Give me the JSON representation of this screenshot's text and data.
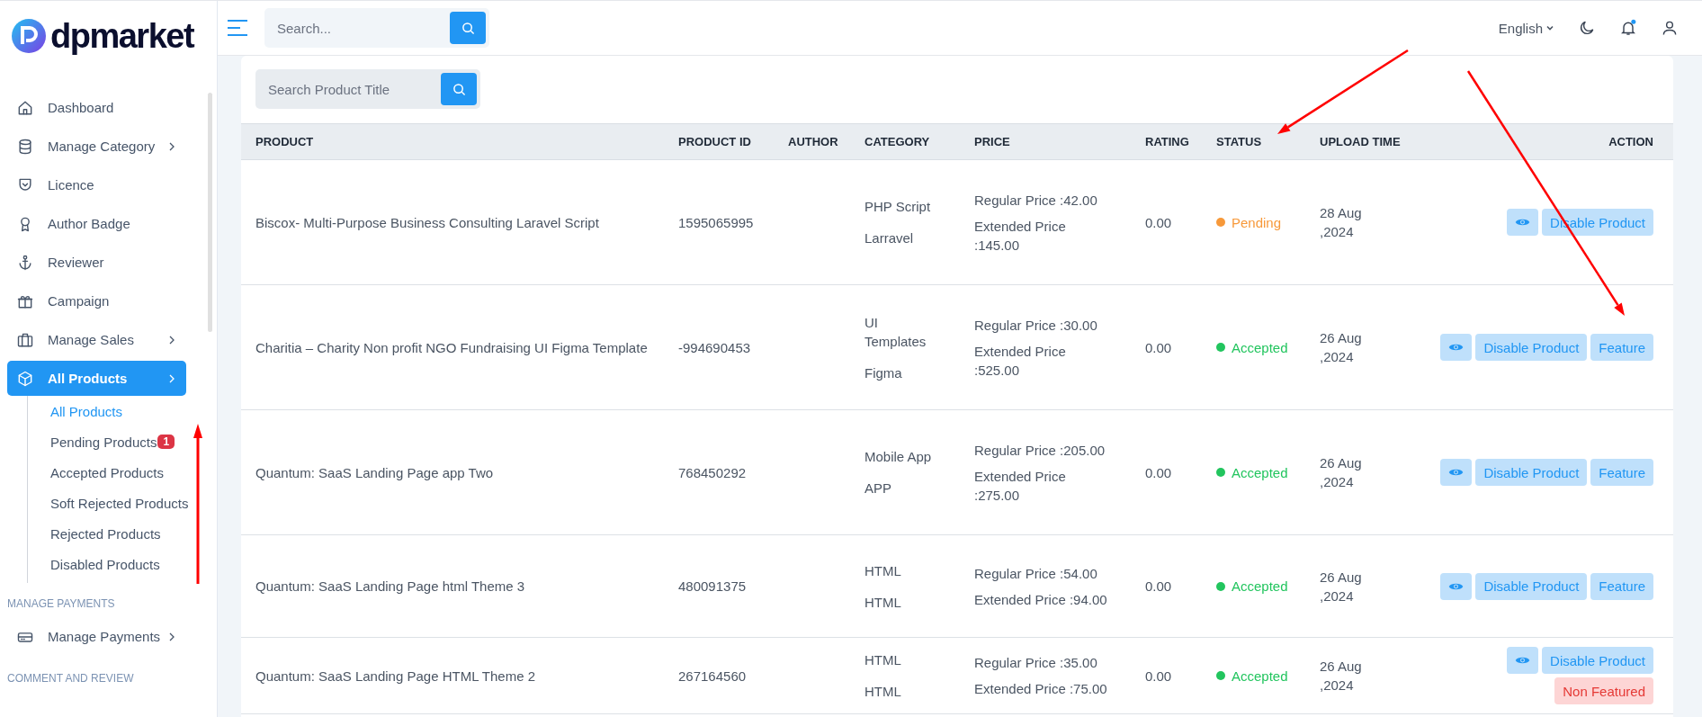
{
  "sidebar": {
    "logo": "dpmarket",
    "groups": [
      {
        "items": [
          {
            "label": "Dashboard",
            "has_submenu": false,
            "selected": false
          },
          {
            "label": "Manage Category",
            "has_submenu": true,
            "selected": false
          },
          {
            "label": "Licence",
            "has_submenu": false,
            "selected": false
          },
          {
            "label": "Author Badge",
            "has_submenu": false,
            "selected": false
          },
          {
            "label": "Reviewer",
            "has_submenu": false,
            "selected": false
          },
          {
            "label": "Campaign",
            "has_submenu": false,
            "selected": false
          },
          {
            "label": "Manage Sales",
            "has_submenu": true,
            "selected": false
          },
          {
            "label": "All Products",
            "has_submenu": true,
            "selected": true,
            "children": [
              {
                "label": "All Products",
                "selected": true
              },
              {
                "label": "Pending Products",
                "selected": false,
                "badge": "1"
              },
              {
                "label": "Accepted Products",
                "selected": false
              },
              {
                "label": "Soft Rejected Products",
                "selected": false
              },
              {
                "label": "Rejected Products",
                "selected": false
              },
              {
                "label": "Disabled Products",
                "selected": false
              }
            ]
          }
        ]
      },
      {
        "heading": "MANAGE PAYMENTS",
        "items": [
          {
            "label": "Manage Payments",
            "has_submenu": true,
            "selected": false
          }
        ]
      },
      {
        "heading": "COMMENT AND REVIEW"
      }
    ]
  },
  "topbar": {
    "search": {
      "placeholder": "Search..."
    },
    "language": "English"
  },
  "product_search": {
    "placeholder": "Search Product Title"
  },
  "table": {
    "columns": [
      "PRODUCT",
      "PRODUCT ID",
      "AUTHOR",
      "CATEGORY",
      "PRICE",
      "RATING",
      "STATUS",
      "UPLOAD TIME",
      "ACTION"
    ],
    "rows": [
      {
        "product": "Biscox- Multi-Purpose Business Consulting Laravel Script",
        "product_id": "1595065995",
        "categories": [
          "PHP Script",
          "Larravel"
        ],
        "regular_price": "Regular Price :42.00",
        "extended_price": "Extended Price :145.00",
        "rating": "0.00",
        "status": {
          "label": "Pending",
          "kind": "pending"
        },
        "upload_time": "28 Aug ,2024",
        "actions": [
          {
            "kind": "view"
          },
          {
            "kind": "disable",
            "label": "Disable Product"
          }
        ]
      },
      {
        "product": "Charitia – Charity Non profit NGO Fundraising UI Figma Template",
        "product_id": "-994690453",
        "categories": [
          "UI Templates",
          "Figma"
        ],
        "regular_price": "Regular Price :30.00",
        "extended_price": "Extended Price :525.00",
        "rating": "0.00",
        "status": {
          "label": "Accepted",
          "kind": "accepted"
        },
        "upload_time": "26 Aug ,2024",
        "actions": [
          {
            "kind": "view"
          },
          {
            "kind": "disable",
            "label": "Disable Product"
          },
          {
            "kind": "feature",
            "label": "Feature"
          }
        ]
      },
      {
        "product": "Quantum: SaaS Landing Page app Two",
        "product_id": "768450292",
        "categories": [
          "Mobile App",
          "APP"
        ],
        "regular_price": "Regular Price :205.00",
        "extended_price": "Extended Price :275.00",
        "rating": "0.00",
        "status": {
          "label": "Accepted",
          "kind": "accepted"
        },
        "upload_time": "26 Aug ,2024",
        "actions": [
          {
            "kind": "view"
          },
          {
            "kind": "disable",
            "label": "Disable Product"
          },
          {
            "kind": "feature",
            "label": "Feature"
          }
        ]
      },
      {
        "product": "Quantum: SaaS Landing Page html Theme 3",
        "product_id": "480091375",
        "categories": [
          "HTML",
          "HTML"
        ],
        "regular_price": "Regular Price :54.00",
        "extended_price": "Extended Price :94.00",
        "rating": "0.00",
        "status": {
          "label": "Accepted",
          "kind": "accepted"
        },
        "upload_time": "26 Aug ,2024",
        "actions": [
          {
            "kind": "view"
          },
          {
            "kind": "disable",
            "label": "Disable Product"
          },
          {
            "kind": "feature",
            "label": "Feature"
          }
        ]
      },
      {
        "product": "Quantum: SaaS Landing Page HTML Theme 2",
        "product_id": "267164560",
        "categories": [
          "HTML",
          "HTML"
        ],
        "regular_price": "Regular Price :35.00",
        "extended_price": "Extended Price :75.00",
        "rating": "0.00",
        "status": {
          "label": "Accepted",
          "kind": "accepted"
        },
        "upload_time": "26 Aug ,2024",
        "actions": [
          {
            "kind": "view"
          },
          {
            "kind": "disable",
            "label": "Disable Product"
          },
          {
            "kind": "non_featured",
            "label": "Non Featured"
          }
        ]
      }
    ]
  }
}
